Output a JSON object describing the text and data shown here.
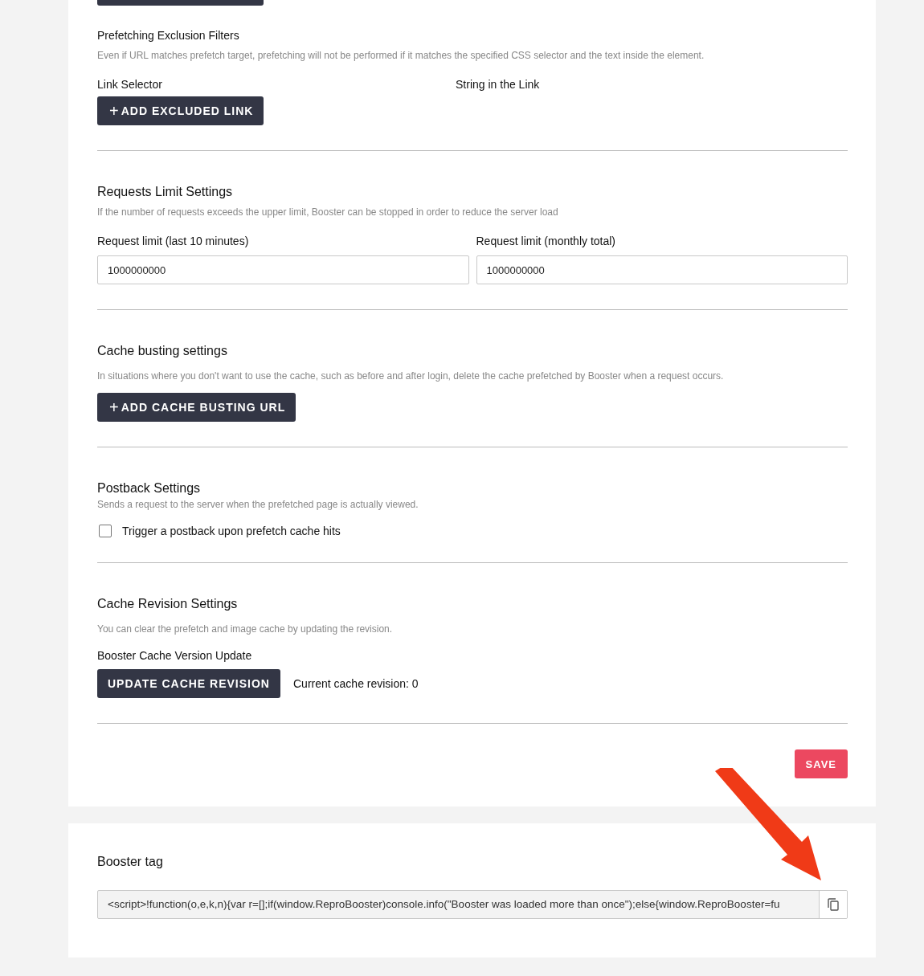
{
  "sections": [
    {
      "kind": "exclusion",
      "title": "Prefetching Exclusion Filters",
      "description": "Even if URL matches prefetch target, prefetching will not be performed if it matches the specified CSS selector and the text inside the element.",
      "columns": [
        "Link Selector",
        "String in the Link"
      ],
      "button": {
        "icon": "+",
        "label": "ADD EXCLUDED LINK"
      }
    },
    {
      "kind": "limits",
      "title": "Requests Limit Settings",
      "description": "If the number of requests exceeds the upper limit, Booster can be stopped in order to reduce the server load",
      "fields": [
        {
          "label": "Request limit (last 10 minutes)",
          "value": "1000000000"
        },
        {
          "label": "Request limit (monthly total)",
          "value": "1000000000"
        }
      ]
    },
    {
      "kind": "busting",
      "title": "Cache busting settings",
      "description": "In situations where you don't want to use the cache, such as before and after login, delete the cache prefetched by Booster when a request occurs.",
      "button": {
        "icon": "+",
        "label": "ADD CACHE BUSTING URL"
      }
    },
    {
      "kind": "postback",
      "title": "Postback Settings",
      "description": "Sends a request to the server when the prefetched page is actually viewed.",
      "checkbox": {
        "label": "Trigger a postback upon prefetch cache hits",
        "checked": false
      }
    },
    {
      "kind": "revision",
      "title": "Cache Revision Settings",
      "description": "You can clear the prefetch and image cache by updating the revision.",
      "label": "Booster Cache Version Update",
      "button": {
        "label": "UPDATE CACHE REVISION"
      },
      "status": "Current cache revision: 0"
    }
  ],
  "save_button": "SAVE",
  "booster_tag": {
    "title": "Booster tag",
    "value": "<script>!function(o,e,k,n){var r=[];if(window.ReproBooster)console.info(\"Booster was loaded more than once\");else{window.ReproBooster=fu"
  }
}
